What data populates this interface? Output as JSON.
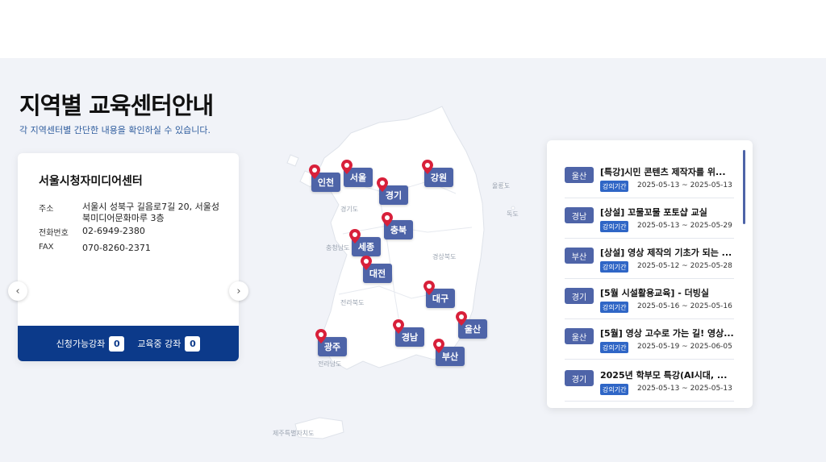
{
  "heading": {
    "title": "지역별 교육센터안내",
    "subtitle": "각 지역센터별 간단한 내용을 확인하실 수 있습니다."
  },
  "center": {
    "name": "서울시청자미디어센터",
    "address_label": "주소",
    "address": "서울시 성북구 길음로7길 20, 서울성북미디어문화마루 3층",
    "phone_label": "전화번호",
    "phone": "02-6949-2380",
    "fax_label": "FAX",
    "fax": "070-8260-2371",
    "available_label": "신청가능강좌",
    "available_count": "0",
    "ongoing_label": "교육중 강좌",
    "ongoing_count": "0"
  },
  "carousel": {
    "prev_icon": "chevron-left-icon",
    "next_icon": "chevron-right-icon"
  },
  "map": {
    "regions": [
      "인천",
      "서울",
      "강원",
      "경기",
      "충북",
      "세종",
      "대전",
      "대구",
      "울산",
      "경남",
      "광주",
      "부산"
    ],
    "labels": [
      "경기도",
      "울릉도",
      "독도",
      "충청남도",
      "경상북도",
      "전라북도",
      "전라남도",
      "제주특별자치도"
    ],
    "pin_color": "#d8203a",
    "button_color": "#4e64a8"
  },
  "lectures": {
    "period_label": "강의기간",
    "items": [
      {
        "region": "울산",
        "title": "[특강]시민 콘텐츠 제작자를 위...",
        "period": "2025-05-13 ~ 2025-05-13"
      },
      {
        "region": "경남",
        "title": "[상설] 꼬물꼬물 포토샵 교실",
        "period": "2025-05-13 ~ 2025-05-29"
      },
      {
        "region": "부산",
        "title": "[상설] 영상 제작의 기초가 되는 ...",
        "period": "2025-05-12 ~ 2025-05-28"
      },
      {
        "region": "경기",
        "title": "[5월 시설활용교육] - 더빙실",
        "period": "2025-05-16 ~ 2025-05-16"
      },
      {
        "region": "울산",
        "title": "[5월] 영상 고수로 가는 길! 영상...",
        "period": "2025-05-19 ~ 2025-06-05"
      },
      {
        "region": "경기",
        "title": "2025년 학부모 특강(AI시대, ...",
        "period": "2025-05-13 ~ 2025-05-13"
      }
    ]
  }
}
